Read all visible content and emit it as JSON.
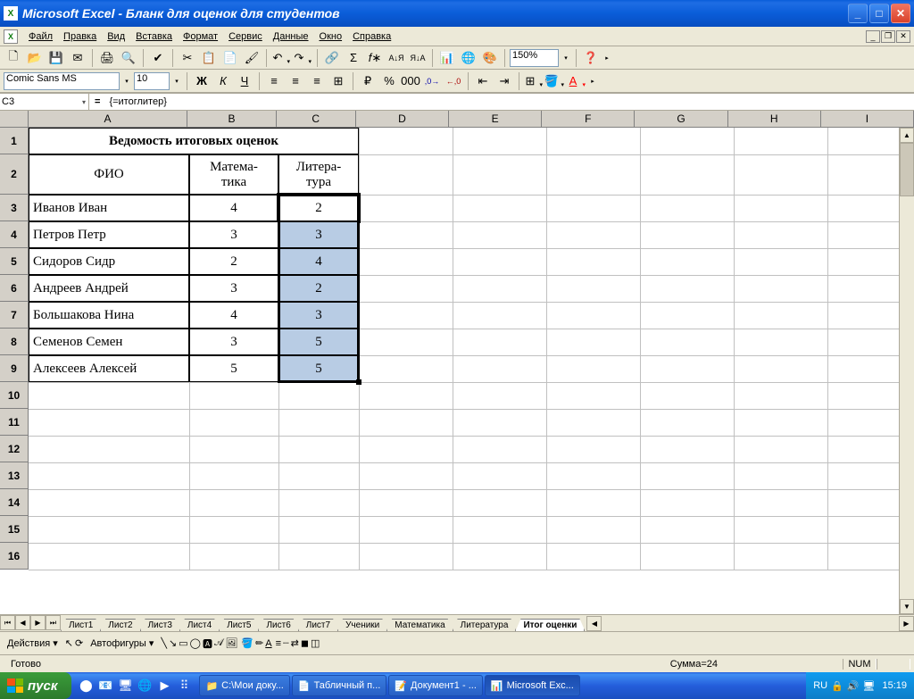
{
  "window": {
    "title": "Microsoft Excel - Бланк для оценок для студентов"
  },
  "menu": {
    "items": [
      "Файл",
      "Правка",
      "Вид",
      "Вставка",
      "Формат",
      "Сервис",
      "Данные",
      "Окно",
      "Справка"
    ]
  },
  "toolbar1": {
    "zoom": "150%"
  },
  "format_bar": {
    "font_name": "Comic Sans MS",
    "font_size": "10"
  },
  "formula_bar": {
    "name_box": "C3",
    "fx_label": "=",
    "formula": "{=итоглитер}"
  },
  "columns": {
    "letters": [
      "A",
      "B",
      "C",
      "D",
      "E",
      "F",
      "G",
      "H",
      "I"
    ],
    "widths": [
      180,
      100,
      90,
      105,
      105,
      105,
      105,
      105,
      105
    ]
  },
  "rows": {
    "heights": [
      30,
      45,
      30,
      30,
      30,
      30,
      30,
      30,
      30,
      30,
      30,
      30,
      30,
      30,
      30,
      30
    ],
    "count": 16
  },
  "sheet": {
    "title": "Ведомость итоговых оценок",
    "headers": {
      "fio": "ФИО",
      "math": "Матема-\nтика",
      "lit": "Литера-\nтура"
    },
    "data": [
      {
        "fio": "Иванов Иван",
        "math": "4",
        "lit": "2"
      },
      {
        "fio": "Петров Петр",
        "math": "3",
        "lit": "3"
      },
      {
        "fio": "Сидоров Сидр",
        "math": "2",
        "lit": "4"
      },
      {
        "fio": "Андреев Андрей",
        "math": "3",
        "lit": "2"
      },
      {
        "fio": "Большакова Нина",
        "math": "4",
        "lit": "3"
      },
      {
        "fio": "Семенов Семен",
        "math": "3",
        "lit": "5"
      },
      {
        "fio": "Алексеев Алексей",
        "math": "5",
        "lit": "5"
      }
    ]
  },
  "tabs": [
    "Лист1",
    "Лист2",
    "Лист3",
    "Лист4",
    "Лист5",
    "Лист6",
    "Лист7",
    "Ученики",
    "Математика",
    "Литература",
    "Итог оценки"
  ],
  "active_tab": "Итог оценки",
  "drawbar": {
    "actions": "Действия",
    "autoshapes": "Автофигуры"
  },
  "status": {
    "ready": "Готово",
    "sum": "Сумма=24",
    "num": "NUM"
  },
  "taskbar": {
    "start": "пуск",
    "buttons": [
      "С:\\Мои доку...",
      "Табличный п...",
      "Документ1 - ...",
      "Microsoft Exc..."
    ],
    "lang": "RU",
    "time": "15:19"
  }
}
